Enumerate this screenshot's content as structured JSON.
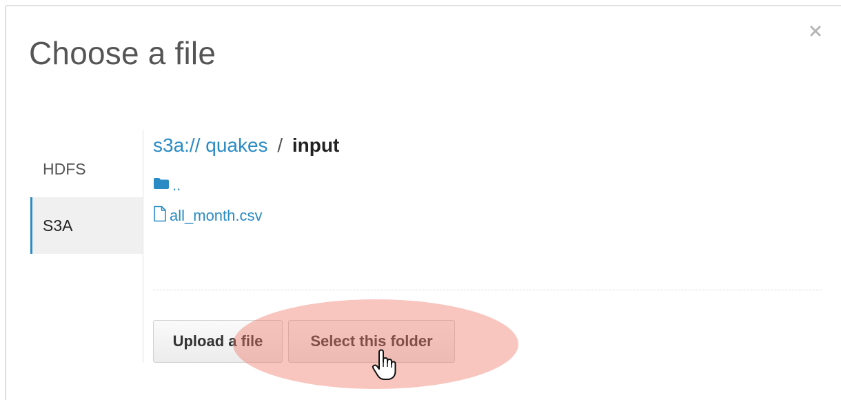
{
  "dialog": {
    "title": "Choose a file",
    "close_icon": "close-icon"
  },
  "sidebar": {
    "items": [
      {
        "label": "HDFS",
        "active": false
      },
      {
        "label": "S3A",
        "active": true
      }
    ]
  },
  "breadcrumb": {
    "scheme": "s3a://",
    "bucket": "quakes",
    "separator": "/",
    "current": "input"
  },
  "files": [
    {
      "name": "..",
      "icon": "folder-icon"
    },
    {
      "name": "all_month.csv",
      "icon": "file-icon"
    }
  ],
  "buttons": {
    "upload_label": "Upload a file",
    "select_label": "Select this folder"
  },
  "colors": {
    "accent": "#2a8bc4",
    "highlight": "#ee7866"
  }
}
